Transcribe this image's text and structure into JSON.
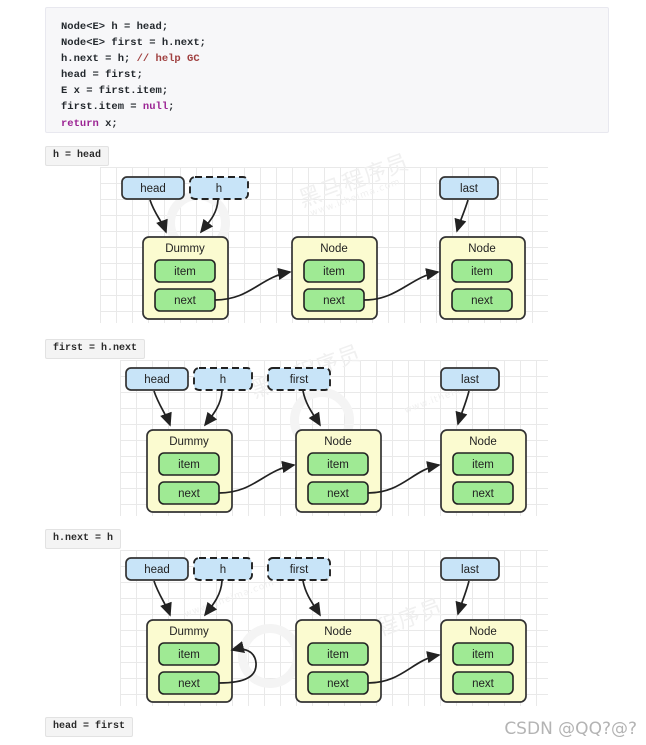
{
  "code": {
    "language": "java",
    "lines": [
      [
        {
          "t": "Node<E> h = head;",
          "c": "tok-type"
        }
      ],
      [
        {
          "t": "Node<E> first = h.next;",
          "c": "tok-type"
        }
      ],
      [
        {
          "t": "h.next = h; ",
          "c": "tok-type"
        },
        {
          "t": "// help GC",
          "c": "tok-cmt"
        }
      ],
      [
        {
          "t": "head = first;",
          "c": "tok-type"
        }
      ],
      [
        {
          "t": "E x = first.item;",
          "c": "tok-type"
        }
      ],
      [
        {
          "t": "first.item = ",
          "c": "tok-type"
        },
        {
          "t": "null",
          "c": "tok-lit"
        },
        {
          "t": ";",
          "c": "tok-type"
        }
      ],
      [
        {
          "t": "return",
          "c": "tok-kw"
        },
        {
          "t": " x;",
          "c": "tok-type"
        }
      ]
    ]
  },
  "colors": {
    "pointer_fill": "#c8e4f8",
    "node_fill": "#fbfbd0",
    "field_fill": "#9fea94",
    "stroke": "#333333",
    "grid": "#e9e9e9",
    "label_bg": "#f4f4f4"
  },
  "steps": [
    {
      "label": "h = head",
      "pointers": [
        {
          "name": "head",
          "dashed": false
        },
        {
          "name": "h",
          "dashed": true
        }
      ],
      "right_pointer": {
        "name": "last",
        "dashed": false
      },
      "nodes": [
        {
          "title": "Dummy",
          "fields": [
            "item",
            "next"
          ]
        },
        {
          "title": "Node",
          "fields": [
            "item",
            "next"
          ]
        },
        {
          "title": "Node",
          "fields": [
            "item",
            "next"
          ]
        }
      ],
      "links": [
        "dummy.next -> node1.item",
        "node1.next -> node2.item"
      ],
      "pointer_targets": [
        "head -> Dummy",
        "h -> Dummy",
        "last -> Node2"
      ]
    },
    {
      "label": "first = h.next",
      "pointers": [
        {
          "name": "head",
          "dashed": false
        },
        {
          "name": "h",
          "dashed": true
        },
        {
          "name": "first",
          "dashed": true
        }
      ],
      "right_pointer": {
        "name": "last",
        "dashed": false
      },
      "nodes": [
        {
          "title": "Dummy",
          "fields": [
            "item",
            "next"
          ]
        },
        {
          "title": "Node",
          "fields": [
            "item",
            "next"
          ]
        },
        {
          "title": "Node",
          "fields": [
            "item",
            "next"
          ]
        }
      ],
      "links": [
        "dummy.next -> node1.item",
        "node1.next -> node2.item"
      ],
      "pointer_targets": [
        "head -> Dummy",
        "h -> Dummy",
        "first -> Node1",
        "last -> Node2"
      ]
    },
    {
      "label": "h.next = h",
      "pointers": [
        {
          "name": "head",
          "dashed": false
        },
        {
          "name": "h",
          "dashed": true
        },
        {
          "name": "first",
          "dashed": true
        }
      ],
      "right_pointer": {
        "name": "last",
        "dashed": false
      },
      "nodes": [
        {
          "title": "Dummy",
          "fields": [
            "item",
            "next"
          ]
        },
        {
          "title": "Node",
          "fields": [
            "item",
            "next"
          ]
        },
        {
          "title": "Node",
          "fields": [
            "item",
            "next"
          ]
        }
      ],
      "links": [
        "dummy.next -> dummy.item (self loop)",
        "node1.next -> node2.item"
      ],
      "pointer_targets": [
        "head -> Dummy",
        "h -> Dummy",
        "first -> Node1",
        "last -> Node2"
      ]
    }
  ],
  "final_label": "head = first",
  "watermark": {
    "text": "黑马程序员",
    "url_text": "www.itheima.com"
  },
  "footer": "CSDN @QQ?@?"
}
